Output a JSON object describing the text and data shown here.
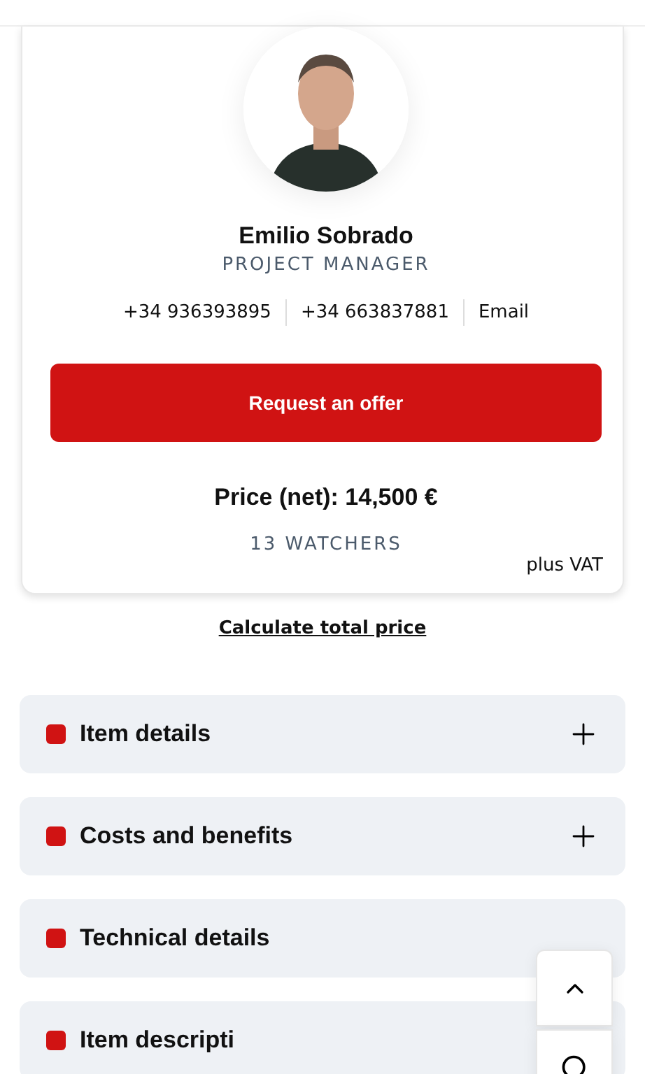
{
  "contact": {
    "name": "Emilio Sobrado",
    "role": "PROJECT MANAGER",
    "avatar": {
      "kind": "picture"
    },
    "links": [
      "+34 936393895",
      "+34 663837881",
      "Email"
    ]
  },
  "offer_button": "Request an offer",
  "price": "Price (net): 14,500 €",
  "watchers": "13 WATCHERS",
  "vat_note": "plus VAT",
  "calculate_link": "Calculate total price",
  "sections": [
    {
      "title": "Item details",
      "expanded": false
    },
    {
      "title": "Costs and benefits",
      "expanded": false
    },
    {
      "title": "Technical details"
    },
    {
      "title": "Item descripti"
    }
  ],
  "floating_buttons": [
    {
      "kind": "scroll-up"
    },
    {
      "kind": "search"
    }
  ]
}
